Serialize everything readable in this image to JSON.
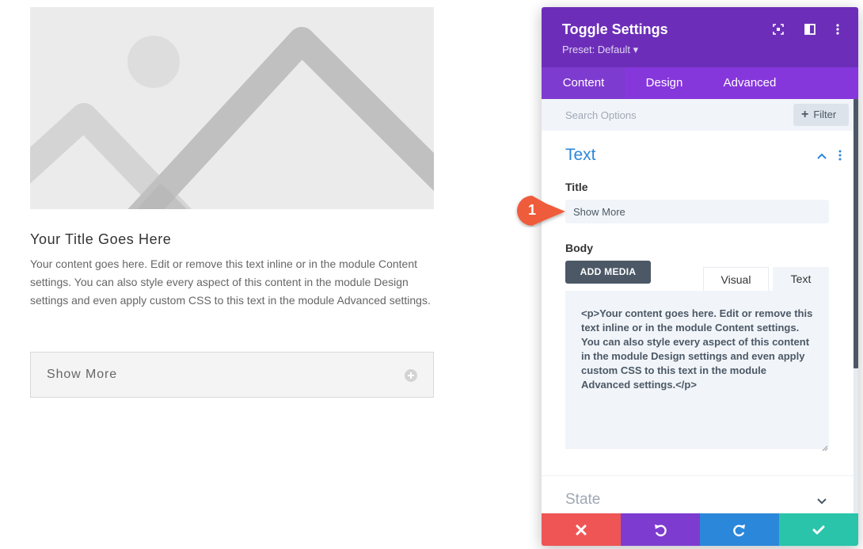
{
  "preview": {
    "image_alt_icon": "placeholder-image-icon",
    "title": "Your Title Goes Here",
    "body": "Your content goes here. Edit or remove this text inline or in the module Content settings. You can also style every aspect of this content in the module Design settings and even apply custom CSS to this text in the module Advanced settings.",
    "toggle_title": "Show More",
    "toggle_icon": "plus-circle-icon"
  },
  "modal": {
    "title": "Toggle Settings",
    "preset": "Preset: Default ▾",
    "header_icons": [
      "fullscreen-icon",
      "split-view-icon",
      "more-options-icon"
    ],
    "tabs": [
      {
        "label": "Content",
        "active": true
      },
      {
        "label": "Design",
        "active": false
      },
      {
        "label": "Advanced",
        "active": false
      }
    ],
    "search": {
      "placeholder": "Search Options",
      "value": ""
    },
    "filter_label": "Filter",
    "filter_icon": "+",
    "sections": {
      "text": {
        "title": "Text",
        "expanded": true,
        "title_field": {
          "label": "Title",
          "value": "Show More"
        },
        "body_field": {
          "label": "Body",
          "add_media_label": "ADD MEDIA",
          "editor_tabs": [
            "Visual",
            "Text"
          ],
          "active_editor_tab": "Text",
          "value": "<p>Your content goes here. Edit or remove this text inline or in the module Content settings. You can also style every aspect of this content in the module Design settings and even apply custom CSS to this text in the module Advanced settings.</p>"
        }
      },
      "state": {
        "title": "State",
        "expanded": false
      }
    },
    "footer": [
      "cancel-icon",
      "undo-icon",
      "redo-icon",
      "save-check-icon"
    ]
  },
  "annotation": {
    "number": "1"
  },
  "colors": {
    "header_purple": "#6c2eb9",
    "tab_purple": "#8637dc",
    "section_blue": "#2b87da",
    "cancel_red": "#ef5555",
    "undo_purple": "#7e3bd0",
    "redo_blue": "#2b87da",
    "save_green": "#29c4a9",
    "callout_orange": "#ef5b3a"
  }
}
